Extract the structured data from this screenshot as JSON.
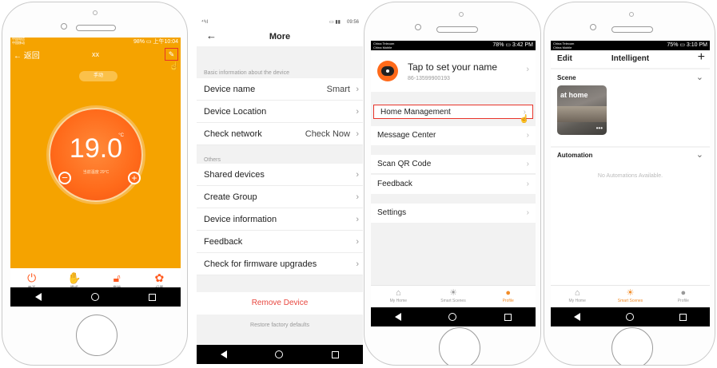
{
  "thermostat": {
    "status_left": "中国电信\n中国移动",
    "status_right": "98% ▭ 上午10:04",
    "back_label": "返回",
    "title": "xx",
    "mode_label": "手动",
    "temperature": "19.0",
    "unit": "°C",
    "current_temp_label": "当前温度 29°C",
    "controls": [
      {
        "label": "开关",
        "icon": "power-icon"
      },
      {
        "label": "模式",
        "icon": "hand-icon"
      },
      {
        "label": "童锁",
        "icon": "lock-icon"
      },
      {
        "label": "设置",
        "icon": "gear-icon"
      }
    ],
    "colors": {
      "accent": "#ff6a1a",
      "background": "#f5a300"
    }
  },
  "more": {
    "status_left": "⁴⁶ıl",
    "status_time": "09:56",
    "title": "More",
    "section_basic": "Basic information about the device",
    "device_name_label": "Device name",
    "device_name_value": "Smart",
    "device_location_label": "Device Location",
    "check_network_label": "Check network",
    "check_network_value": "Check Now",
    "section_others": "Others",
    "items": [
      "Shared devices",
      "Create Group",
      "Device information",
      "Feedback",
      "Check for firmware upgrades"
    ],
    "remove_label": "Remove Device",
    "restore_label": "Restore factory defaults",
    "colors": {
      "remove": "#e8473f"
    }
  },
  "profile": {
    "carrier": "China Telecom\nChina Mobile",
    "status_right": "78% ▭ 3:42 PM",
    "set_name_label": "Tap to set your name",
    "phone": "86-13599900193",
    "menu": [
      "Home Management",
      "Message Center",
      "Scan QR Code",
      "Feedback",
      "Settings"
    ],
    "tabs": [
      {
        "label": "My Home",
        "icon": "home-icon"
      },
      {
        "label": "Smart Scenes",
        "icon": "sun-icon"
      },
      {
        "label": "Profile",
        "icon": "profile-icon"
      }
    ]
  },
  "intelligent": {
    "carrier": "China Telecom\nChina Mobile",
    "status_right": "75% ▭ 3:10 PM",
    "edit_label": "Edit",
    "title": "Intelligent",
    "add_label": "+",
    "scene_label": "Scene",
    "scene_card_label": "at home",
    "automation_label": "Automation",
    "empty_label": "No Automations Available.",
    "tabs": [
      {
        "label": "My Home",
        "icon": "home-icon"
      },
      {
        "label": "Smart Scenes",
        "icon": "sun-icon"
      },
      {
        "label": "Profile",
        "icon": "profile-icon"
      }
    ]
  }
}
